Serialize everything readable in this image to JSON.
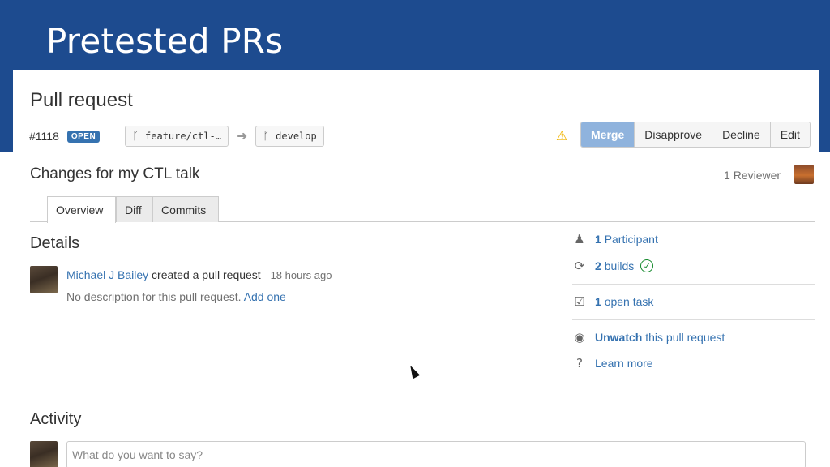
{
  "slide": {
    "title": "Pretested PRs"
  },
  "pr": {
    "heading": "Pull request",
    "id": "#1118",
    "status": "OPEN",
    "source_branch": "feature/ctl-…",
    "target_branch": "develop",
    "title": "Changes for my CTL talk"
  },
  "actions": {
    "merge": "Merge",
    "disapprove": "Disapprove",
    "decline": "Decline",
    "edit": "Edit"
  },
  "reviewers": {
    "count": "1",
    "label": "Reviewer"
  },
  "tabs": [
    {
      "label": "Overview"
    },
    {
      "label": "Diff"
    },
    {
      "label": "Commits"
    }
  ],
  "details": {
    "heading": "Details",
    "author": "Michael J Bailey",
    "action_text": "created a pull request",
    "time": "18 hours ago",
    "no_description": "No description for this pull request.",
    "add_link": "Add one"
  },
  "sidebar": {
    "participants_count": "1",
    "participants_label": "Participant",
    "builds_count": "2",
    "builds_label": "builds",
    "tasks_count": "1",
    "tasks_label": "open task",
    "unwatch": "Unwatch",
    "unwatch_rest": "this pull request",
    "learn_more": "Learn more"
  },
  "activity": {
    "heading": "Activity",
    "placeholder": "What do you want to say?"
  },
  "colors": {
    "header_bg": "#1d4b8f",
    "link": "#3572b0",
    "merge_bg": "#8fb3dd",
    "success": "#14892c"
  }
}
